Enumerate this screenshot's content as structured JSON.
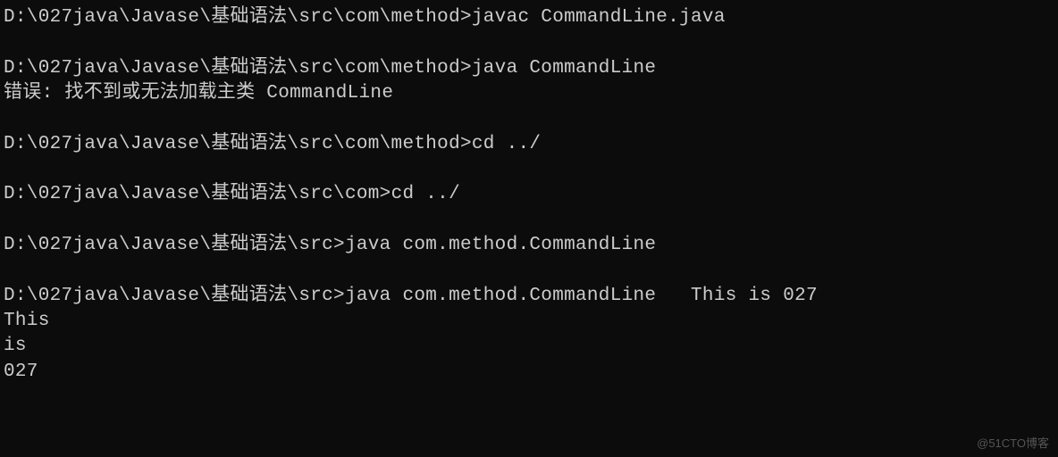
{
  "terminal": {
    "lines": [
      {
        "type": "cmd",
        "prompt": "D:\\027java\\Javase\\基础语法\\src\\com\\method>",
        "command": "javac CommandLine.java"
      },
      {
        "type": "blank"
      },
      {
        "type": "cmd",
        "prompt": "D:\\027java\\Javase\\基础语法\\src\\com\\method>",
        "command": "java CommandLine"
      },
      {
        "type": "out",
        "text": "错误: 找不到或无法加载主类 CommandLine"
      },
      {
        "type": "blank"
      },
      {
        "type": "cmd",
        "prompt": "D:\\027java\\Javase\\基础语法\\src\\com\\method>",
        "command": "cd ../"
      },
      {
        "type": "blank"
      },
      {
        "type": "cmd",
        "prompt": "D:\\027java\\Javase\\基础语法\\src\\com>",
        "command": "cd ../"
      },
      {
        "type": "blank"
      },
      {
        "type": "cmd",
        "prompt": "D:\\027java\\Javase\\基础语法\\src>",
        "command": "java com.method.CommandLine"
      },
      {
        "type": "blank"
      },
      {
        "type": "cmd",
        "prompt": "D:\\027java\\Javase\\基础语法\\src>",
        "command": "java com.method.CommandLine   This is 027"
      },
      {
        "type": "out",
        "text": "This"
      },
      {
        "type": "out",
        "text": "is"
      },
      {
        "type": "out",
        "text": "027"
      }
    ]
  },
  "watermark": "@51CTO博客"
}
